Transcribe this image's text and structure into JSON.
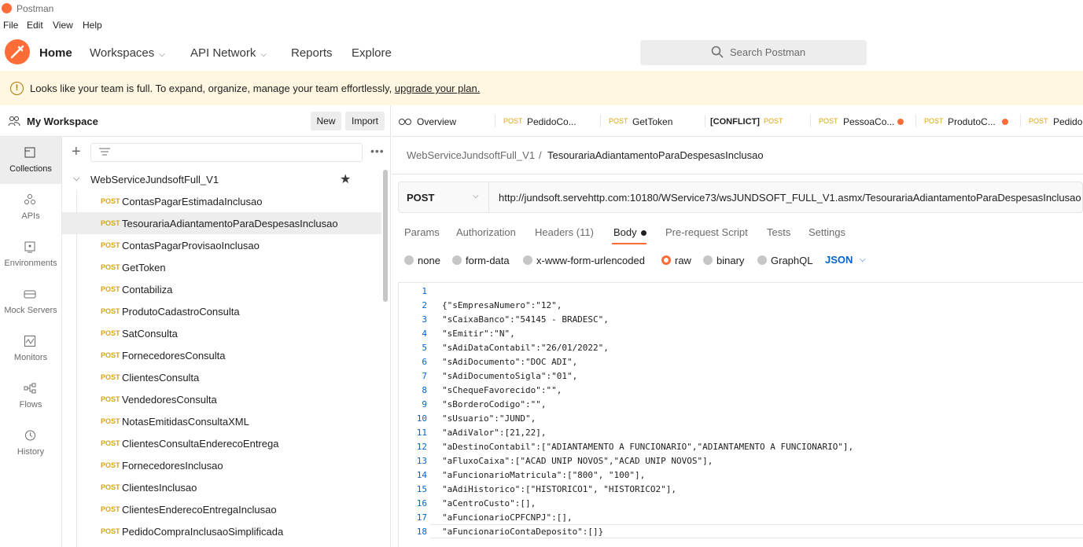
{
  "window": {
    "title": "Postman"
  },
  "menu": [
    "File",
    "Edit",
    "View",
    "Help"
  ],
  "header": {
    "home": "Home",
    "workspaces": "Workspaces",
    "api_network": "API Network",
    "reports": "Reports",
    "explore": "Explore",
    "search_placeholder": "Search Postman"
  },
  "banner": {
    "message": "Looks like your team is full. To expand, organize, manage your team effortlessly, ",
    "link": "upgrade your plan."
  },
  "sidebar": {
    "workspace": "My Workspace",
    "new_label": "New",
    "import_label": "Import",
    "rail": [
      {
        "label": "Collections",
        "icon": "collections-icon"
      },
      {
        "label": "APIs",
        "icon": "apis-icon"
      },
      {
        "label": "Environments",
        "icon": "environments-icon"
      },
      {
        "label": "Mock Servers",
        "icon": "mock-servers-icon"
      },
      {
        "label": "Monitors",
        "icon": "monitors-icon"
      },
      {
        "label": "Flows",
        "icon": "flows-icon"
      },
      {
        "label": "History",
        "icon": "history-icon"
      }
    ],
    "collection": "WebServiceJundsoftFull_V1",
    "requests": [
      {
        "method": "POST",
        "name": "ContasPagarEstimadaInclusao"
      },
      {
        "method": "POST",
        "name": "TesourariaAdiantamentoParaDespesasInclusao"
      },
      {
        "method": "POST",
        "name": "ContasPagarProvisaoInclusao"
      },
      {
        "method": "POST",
        "name": "GetToken"
      },
      {
        "method": "POST",
        "name": "Contabiliza"
      },
      {
        "method": "POST",
        "name": "ProdutoCadastroConsulta"
      },
      {
        "method": "POST",
        "name": "SatConsulta"
      },
      {
        "method": "POST",
        "name": "FornecedoresConsulta"
      },
      {
        "method": "POST",
        "name": "ClientesConsulta"
      },
      {
        "method": "POST",
        "name": "VendedoresConsulta"
      },
      {
        "method": "POST",
        "name": "NotasEmitidasConsultaXML"
      },
      {
        "method": "POST",
        "name": "ClientesConsultaEnderecoEntrega"
      },
      {
        "method": "POST",
        "name": "FornecedoresInclusao"
      },
      {
        "method": "POST",
        "name": "ClientesInclusao"
      },
      {
        "method": "POST",
        "name": "ClientesEnderecoEntregaInclusao"
      },
      {
        "method": "POST",
        "name": "PedidoCompraInclusaoSimplificada"
      }
    ]
  },
  "tabs": [
    {
      "method": "",
      "label": "Overview"
    },
    {
      "method": "POST",
      "label": "PedidoCo..."
    },
    {
      "method": "POST",
      "label": "GetToken"
    },
    {
      "method": "POST",
      "label": "[CONFLICT]"
    },
    {
      "method": "POST",
      "label": "PessoaCo..."
    },
    {
      "method": "POST",
      "label": "ProdutoC..."
    },
    {
      "method": "POST",
      "label": "PedidoC"
    }
  ],
  "breadcrumb": {
    "collection": "WebServiceJundsoftFull_V1",
    "separator": "/",
    "request": "TesourariaAdiantamentoParaDespesasInclusao"
  },
  "request": {
    "method": "POST",
    "url": "http://jundsoft.servehttp.com:10180/WService73/wsJUNDSOFT_FULL_V1.asmx/TesourariaAdiantamentoParaDespesasInclusao ..."
  },
  "request_tabs": {
    "params": "Params",
    "authorization": "Authorization",
    "headers": "Headers (11)",
    "body": "Body",
    "prerequest": "Pre-request Script",
    "tests": "Tests",
    "settings": "Settings"
  },
  "body_options": {
    "none": "none",
    "form_data": "form-data",
    "urlencoded": "x-www-form-urlencoded",
    "raw": "raw",
    "binary": "binary",
    "graphql": "GraphQL",
    "format": "JSON",
    "selected": "raw"
  },
  "editor": {
    "lines": [
      "",
      "{\"sEmpresaNumero\":\"12\",",
      "\"sCaixaBanco\":\"54145 - BRADESC\",",
      "\"sEmitir\":\"N\",",
      "\"sAdiDataContabil\":\"26/01/2022\",",
      "\"sAdiDocumento\":\"DOC ADI\",",
      "\"sAdiDocumentoSigla\":\"01\",",
      "\"sChequeFavorecido\":\"\",",
      "\"sBorderoCodigo\":\"\",",
      "\"sUsuario\":\"JUND\",",
      "\"aAdiValor\":[21,22],",
      "\"aDestinoContabil\":[\"ADIANTAMENTO A FUNCIONARIO\",\"ADIANTAMENTO A FUNCIONARIO\"],",
      "\"aFluxoCaixa\":[\"ACAD UNIP NOVOS\",\"ACAD UNIP NOVOS\"],",
      "\"aFuncionarioMatricula\":[\"800\", \"100\"],",
      "\"aAdiHistorico\":[\"HISTORICO1\", \"HISTORICO2\"],",
      "\"aCentroCusto\":[],",
      "\"aFuncionarioCPFCNPJ\":[],",
      "\"aFuncionarioContaDeposito\":[]}"
    ]
  },
  "colors": {
    "accent": "#ff6c37",
    "post": "#d9a60a",
    "link": "#0265d2",
    "banner": "#fff7e1"
  }
}
